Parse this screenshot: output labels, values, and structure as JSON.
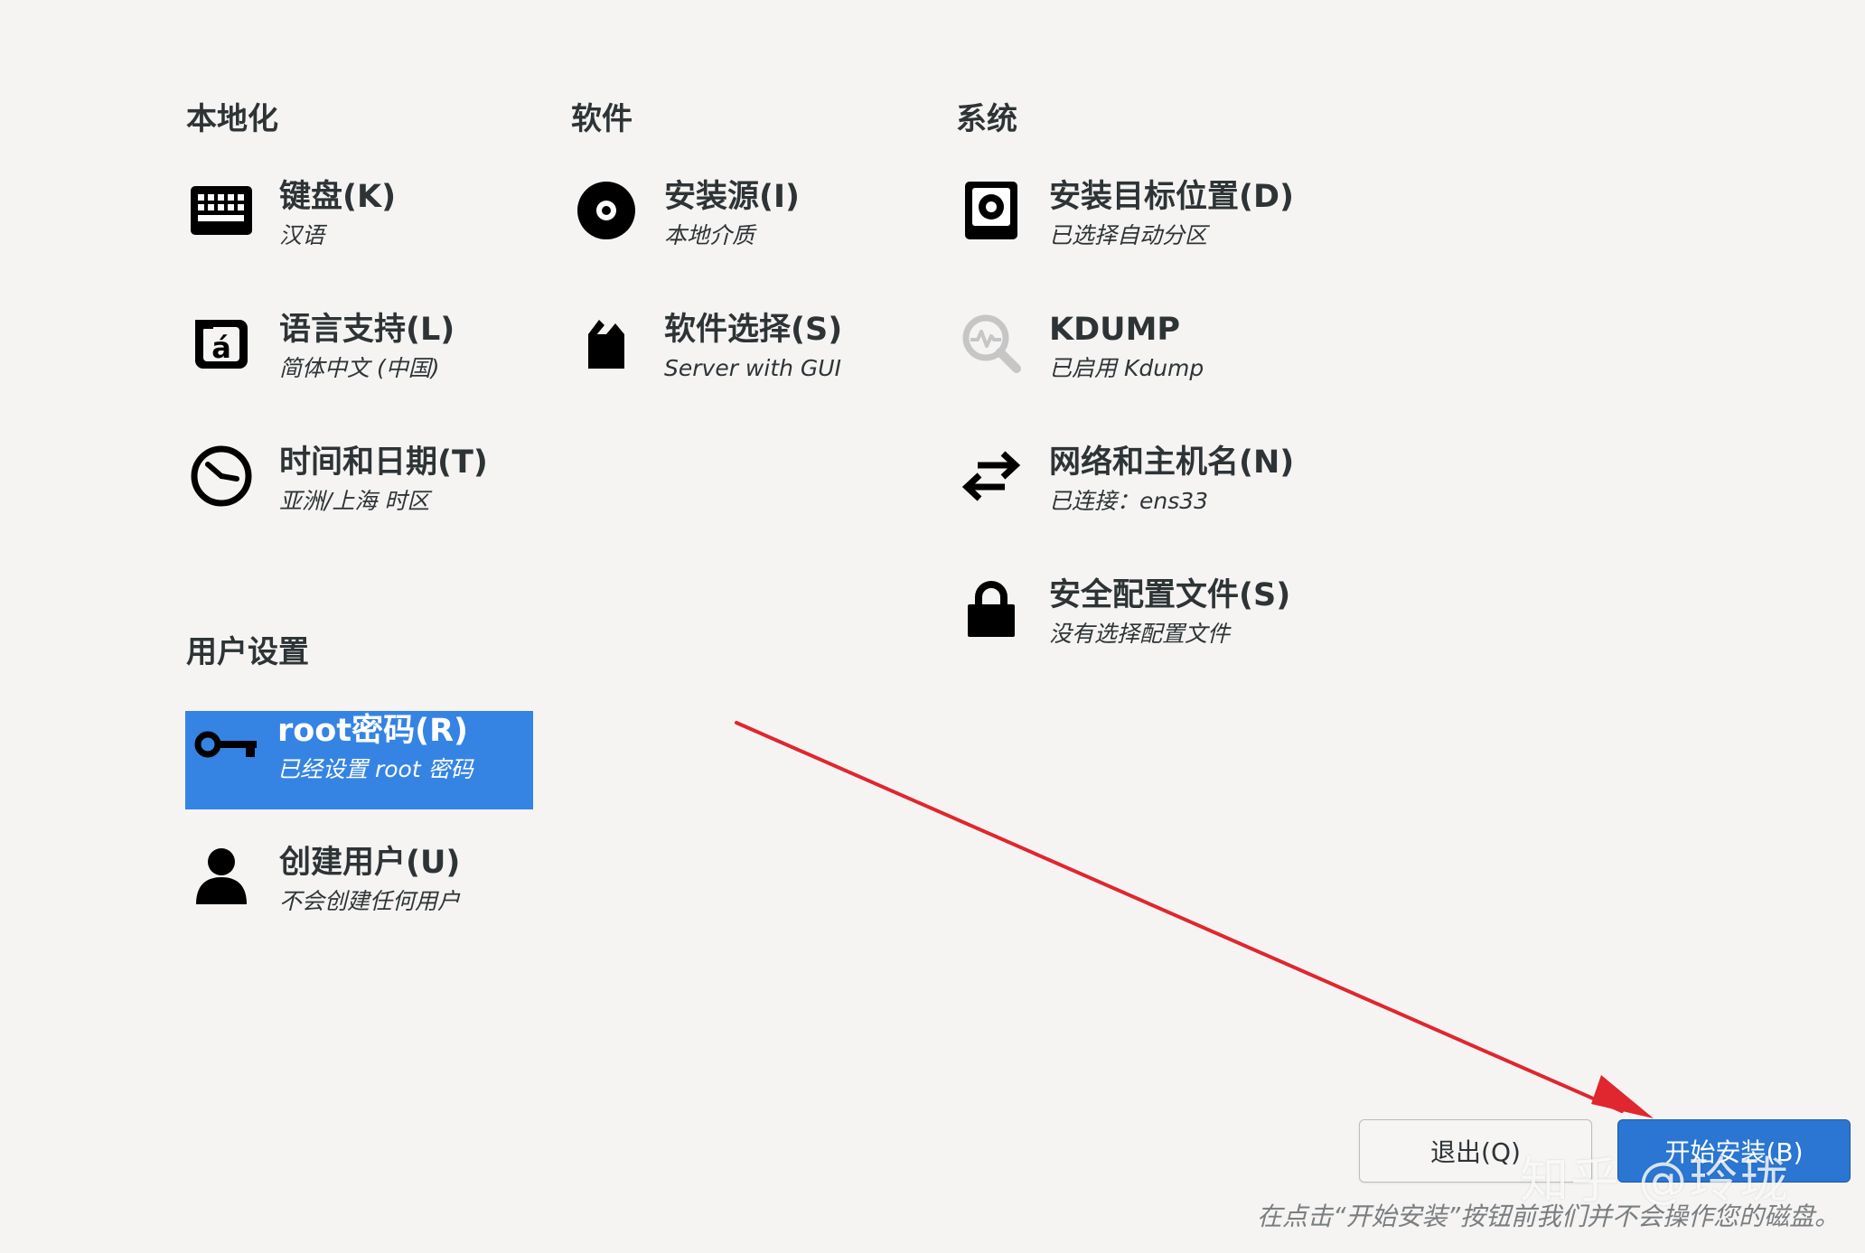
{
  "sections": {
    "localization": "本地化",
    "software": "软件",
    "system": "系统",
    "user_settings": "用户设置"
  },
  "spokes": {
    "keyboard": {
      "title": "键盘(K)",
      "status": "汉语",
      "icon": "keyboard-icon"
    },
    "language": {
      "title": "语言支持(L)",
      "status": "简体中文 (中国)",
      "icon": "language-icon"
    },
    "datetime": {
      "title": "时间和日期(T)",
      "status": "亚洲/上海 时区",
      "icon": "clock-icon"
    },
    "install_source": {
      "title": "安装源(I)",
      "status": "本地介质",
      "icon": "disc-icon"
    },
    "software_selection": {
      "title": "软件选择(S)",
      "status": "Server with GUI",
      "icon": "package-icon"
    },
    "install_destination": {
      "title": "安装目标位置(D)",
      "status": "已选择自动分区",
      "icon": "harddisk-icon"
    },
    "kdump": {
      "title": "KDUMP",
      "status": "已启用 Kdump",
      "icon": "magnifier-icon"
    },
    "network": {
      "title": "网络和主机名(N)",
      "status": "已连接：ens33",
      "icon": "network-arrows-icon"
    },
    "security": {
      "title": "安全配置文件(S)",
      "status": "没有选择配置文件",
      "icon": "lock-icon"
    },
    "root_password": {
      "title": "root密码(R)",
      "status": "已经设置 root 密码",
      "icon": "key-icon",
      "selected": true
    },
    "create_user": {
      "title": "创建用户(U)",
      "status": "不会创建任何用户",
      "icon": "user-icon"
    }
  },
  "buttons": {
    "quit": "退出(Q)",
    "begin_install": "开始安装(B)"
  },
  "footnote": "在点击“开始安装”按钮前我们并不会操作您的磁盘。",
  "watermark": "知乎 @玲珑",
  "colors": {
    "background": "#f5f4f3",
    "selected": "#3584e4",
    "primary_button": "#2a76d2",
    "annotation_arrow": "#e0262e"
  }
}
